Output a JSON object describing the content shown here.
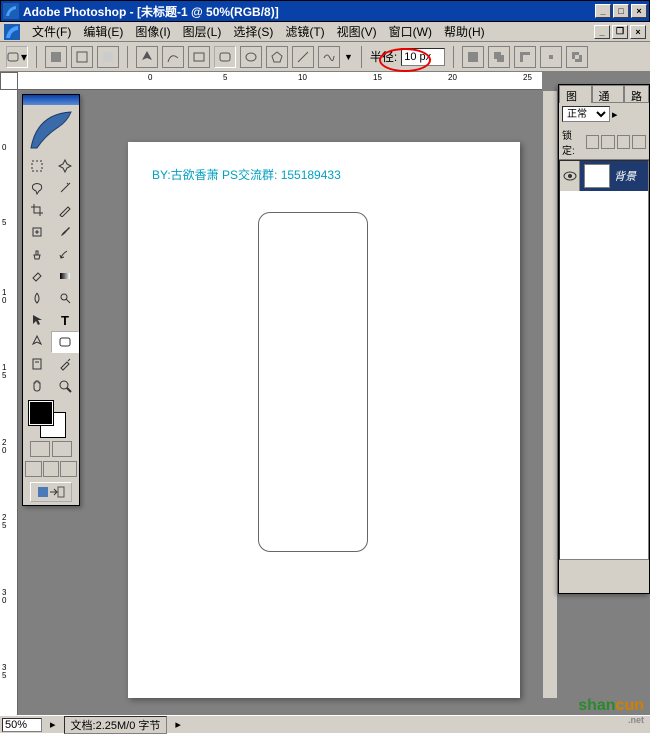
{
  "titlebar": {
    "app": "Adobe Photoshop",
    "doc": "[未标题-1 @ 50%(RGB/8)]"
  },
  "menu": {
    "file": "文件(F)",
    "edit": "编辑(E)",
    "image": "图像(I)",
    "layer": "图层(L)",
    "select": "选择(S)",
    "filter": "滤镜(T)",
    "view": "视图(V)",
    "window": "窗口(W)",
    "help": "帮助(H)"
  },
  "options": {
    "radius_label": "半径:",
    "radius_value": "10 px"
  },
  "canvas": {
    "credit": "BY:古欲香萧 PS交流群: 155189433"
  },
  "layers": {
    "tab_layers": "图层",
    "tab_channels": "通道",
    "tab_paths": "路",
    "blendmode": "正常",
    "lock_label": "锁定:",
    "bg_layer": "背景"
  },
  "status": {
    "zoom": "50%",
    "docinfo": "文档:2.25M/0 字节"
  },
  "ruler_h": [
    "0",
    "5",
    "10",
    "15",
    "20",
    "25"
  ],
  "ruler_v": [
    "0",
    "5",
    "1",
    "0",
    "1",
    "5",
    "2",
    "0",
    "2",
    "5",
    "3",
    "0",
    "3",
    "5"
  ],
  "watermark": {
    "brand_a": "shan",
    "brand_b": "cun",
    "tld": ".net"
  }
}
